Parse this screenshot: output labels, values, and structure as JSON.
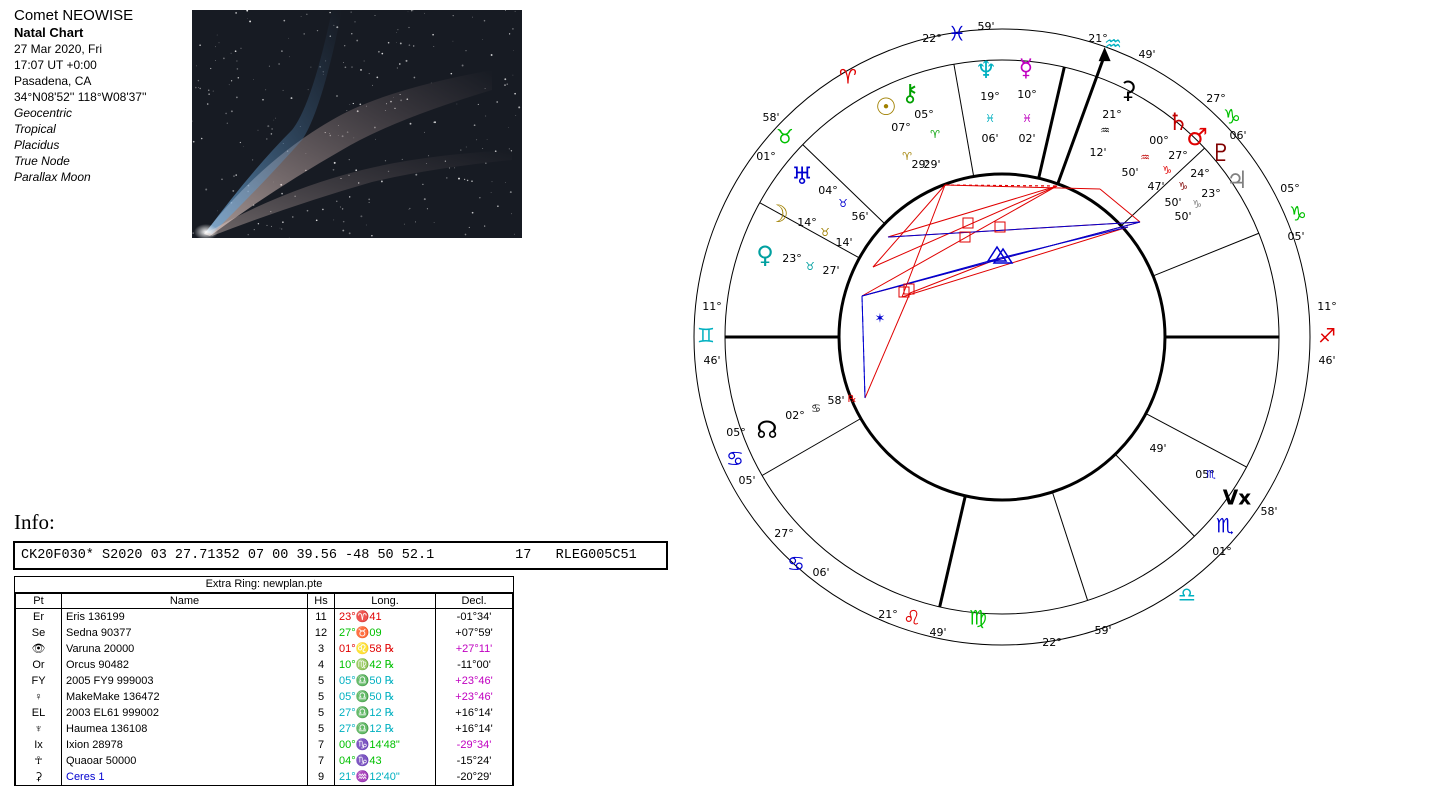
{
  "header": {
    "title": "Comet NEOWISE",
    "chart_type": "Natal Chart",
    "date": "27 Mar 2020, Fri",
    "time": "17:07  UT +0:00",
    "place": "Pasadena, CA",
    "coords": "34°N08'52'' 118°W08'37''",
    "options": [
      "Geocentric",
      "Tropical",
      "Placidus",
      "True Node",
      "Parallax Moon"
    ]
  },
  "info": {
    "label": "Info:",
    "record": "CK20F030* S2020 03 27.71352 07 00 39.56 -48 50 52.1          17   RLEG005C51"
  },
  "table": {
    "caption": "Extra Ring: newplan.pte",
    "headers": [
      "Pt",
      "Name",
      "Hs",
      "Long.",
      "Decl."
    ],
    "rows": [
      {
        "pt": "Er",
        "name": "Eris 136199",
        "hs": "11",
        "long": "23°♈41",
        "decl": "-01°34'",
        "lc": "#e00000",
        "dc": "#000000",
        "nc": "#000000"
      },
      {
        "pt": "Se",
        "name": "Sedna 90377",
        "hs": "12",
        "long": "27°♉09",
        "decl": "+07°59'",
        "lc": "#00c000",
        "dc": "#000000",
        "nc": "#000000"
      },
      {
        "pt": "👁",
        "name": "Varuna 20000",
        "hs": "3",
        "long": "01°♌58 ℞",
        "decl": "+27°11'",
        "lc": "#e00000",
        "dc": "#c000c0",
        "nc": "#000000"
      },
      {
        "pt": "Or",
        "name": "Orcus 90482",
        "hs": "4",
        "long": "10°♍42 ℞",
        "decl": "-11°00'",
        "lc": "#00c000",
        "dc": "#000000",
        "nc": "#000000"
      },
      {
        "pt": "FY",
        "name": "2005 FY9 999003",
        "hs": "5",
        "long": "05°♎50 ℞",
        "decl": "+23°46'",
        "lc": "#00b0c0",
        "dc": "#c000c0",
        "nc": "#000000"
      },
      {
        "pt": "♀",
        "name": "MakeMake 136472",
        "hs": "5",
        "long": "05°♎50 ℞",
        "decl": "+23°46'",
        "lc": "#00b0c0",
        "dc": "#c000c0",
        "nc": "#000000"
      },
      {
        "pt": "EL",
        "name": "2003 EL61 999002",
        "hs": "5",
        "long": "27°♎12 ℞",
        "decl": "+16°14'",
        "lc": "#00b0c0",
        "dc": "#000000",
        "nc": "#000000"
      },
      {
        "pt": "♆",
        "name": "Haumea 136108",
        "hs": "5",
        "long": "27°♎12 ℞",
        "decl": "+16°14'",
        "lc": "#00b0c0",
        "dc": "#000000",
        "nc": "#000000"
      },
      {
        "pt": "Ix",
        "name": "Ixion 28978",
        "hs": "7",
        "long": "00°♑14'48\"",
        "decl": "-29°34'",
        "lc": "#00c000",
        "dc": "#c000c0",
        "nc": "#000000"
      },
      {
        "pt": "☥",
        "name": "Quaoar 50000",
        "hs": "7",
        "long": "04°♑43",
        "decl": "-15°24'",
        "lc": "#00c000",
        "dc": "#000000",
        "nc": "#000000"
      },
      {
        "pt": "⚳",
        "name": "Ceres 1",
        "hs": "9",
        "long": "21°♒12'40\"",
        "decl": "-20°29'",
        "lc": "#00b0c0",
        "dc": "#000000",
        "nc": "#0000d0"
      }
    ]
  },
  "wheel": {
    "signs": [
      {
        "glyph": "♓",
        "color": "#0000d0"
      },
      {
        "glyph": "♒",
        "color": "#00b0c0"
      },
      {
        "glyph": "♑",
        "color": "#00c000"
      },
      {
        "glyph": "♑",
        "color": "#00c000"
      },
      {
        "glyph": "♐",
        "color": "#e00000"
      },
      {
        "glyph": "♏",
        "color": "#0000d0"
      },
      {
        "glyph": "♎",
        "color": "#00b0c0"
      },
      {
        "glyph": "♍",
        "color": "#00c000"
      },
      {
        "glyph": "♌",
        "color": "#e00000"
      },
      {
        "glyph": "♋",
        "color": "#0000d0"
      },
      {
        "glyph": "♋",
        "color": "#0000d0"
      },
      {
        "glyph": "♊",
        "color": "#00b0c0"
      },
      {
        "glyph": "♉",
        "color": "#00c000"
      },
      {
        "glyph": "♈",
        "color": "#e00000"
      }
    ],
    "cusp_labels": [
      "22°",
      "59'",
      "21°",
      "49'",
      "27°",
      "06'",
      "05°",
      "05'",
      "11°",
      "46'",
      "49'",
      "05°",
      "58'",
      "01°",
      "22°",
      "59'",
      "21°",
      "49'",
      "27°",
      "06'",
      "05°",
      "05'",
      "11°",
      "46'",
      "58'",
      "01°"
    ],
    "planets": [
      {
        "glyph": "♆",
        "deg": "19°",
        "sign": "♓",
        "min": "06'",
        "color": "#00b0c0"
      },
      {
        "glyph": "☿",
        "deg": "10°",
        "sign": "♓",
        "min": "02'",
        "color": "#c000c0"
      },
      {
        "glyph": "☉",
        "deg": "07°",
        "sign": "♈",
        "min": "29'",
        "color": "#a08000"
      },
      {
        "glyph": "⚷",
        "deg": "05°",
        "sign": "♈",
        "min": "29'",
        "color": "#00a000"
      },
      {
        "glyph": "♅",
        "deg": "04°",
        "sign": "♉",
        "min": "56'",
        "color": "#0000d0"
      },
      {
        "glyph": "☽",
        "deg": "14°",
        "sign": "♉",
        "min": "14'",
        "color": "#a08000"
      },
      {
        "glyph": "♀",
        "deg": "23°",
        "sign": "♉",
        "min": "27'",
        "color": "#00a0a0"
      },
      {
        "glyph": "☊",
        "deg": "02°",
        "sign": "♋",
        "min": "58'",
        "color": "#000000"
      },
      {
        "glyph": "⚳",
        "deg": "21°",
        "sign": "♒",
        "min": "12'",
        "color": "#000000"
      },
      {
        "glyph": "♄",
        "deg": "00°",
        "sign": "♒",
        "min": "50'",
        "color": "#c00000"
      },
      {
        "glyph": "♂",
        "deg": "27°",
        "sign": "♑",
        "min": "47'",
        "color": "#e00000"
      },
      {
        "glyph": "♇",
        "deg": "24°",
        "sign": "♑",
        "min": "50'",
        "color": "#800000"
      },
      {
        "glyph": "♃",
        "deg": "23°",
        "sign": "♑",
        "min": "50'",
        "color": "#808080"
      }
    ],
    "vertex_glyph": "Vx",
    "vertex_deg": "05°",
    "vertex_sign": "♏",
    "vertex_min": "49'",
    "retro_mark": "℞"
  }
}
